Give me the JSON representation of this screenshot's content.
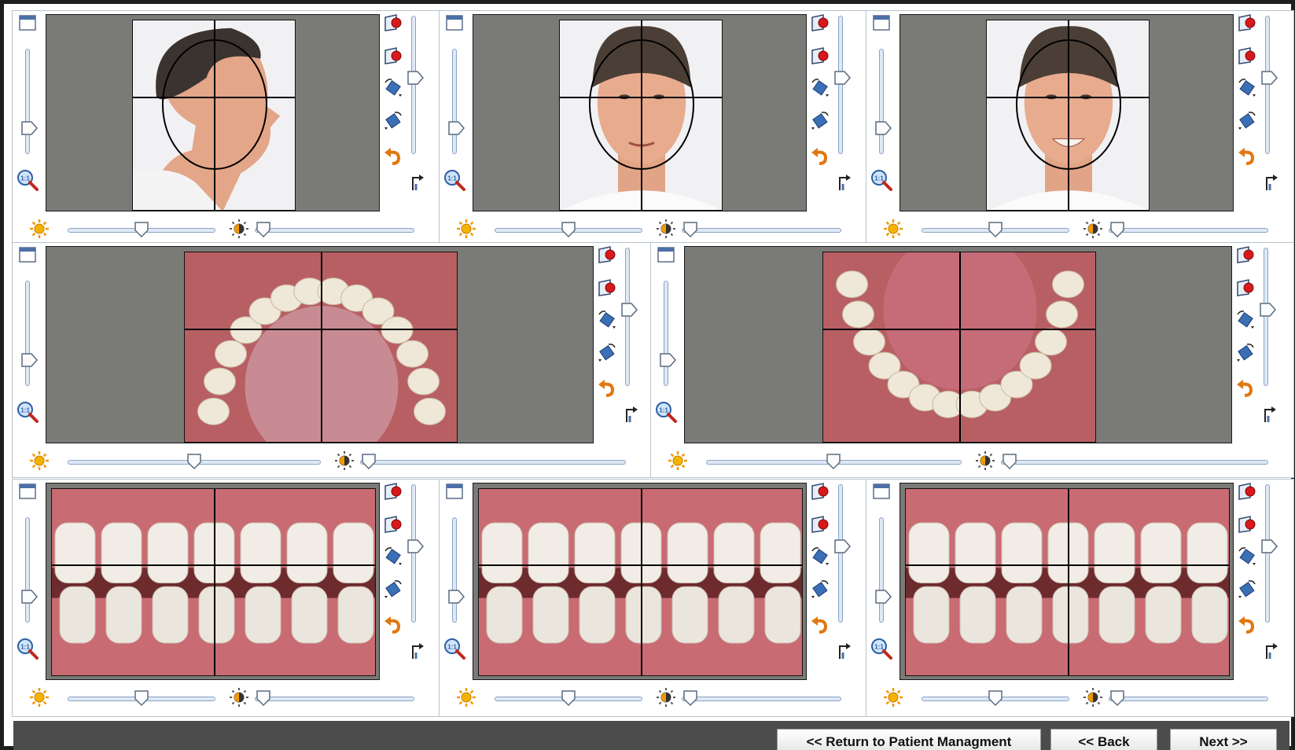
{
  "toolbar_icons": {
    "window": "window-icon",
    "zoom_actual": "zoom-actual-size-icon",
    "zoom_actual_label": "1:1",
    "capture_a": "capture-icon",
    "capture_b": "capture-icon",
    "rotate_cw": "rotate-clockwise-icon",
    "rotate_ccw": "rotate-counterclockwise-icon",
    "undo": "undo-icon",
    "flip": "flip-icon",
    "brightness": "brightness-icon",
    "contrast": "contrast-icon"
  },
  "colors": {
    "view_background": "#7a7a77",
    "panel_border": "#b9c3cc",
    "slider_fill": "#dfe8f4",
    "bottom_bar": "#4c4c4c",
    "capture_red": "#d9181b",
    "diamond_blue": "#3b6fb6"
  },
  "panels": [
    {
      "id": "extraoral-profile",
      "photo": "profile-face-photo",
      "overlay": "grid-oval"
    },
    {
      "id": "extraoral-frontal",
      "photo": "frontal-face-photo",
      "overlay": "grid-oval"
    },
    {
      "id": "extraoral-smile",
      "photo": "smiling-face-photo",
      "overlay": "grid-oval"
    },
    {
      "id": "intraoral-upper-occlusal",
      "photo": "upper-arch-photo",
      "overlay": "grid"
    },
    {
      "id": "intraoral-lower-occlusal",
      "photo": "lower-arch-photo",
      "overlay": "grid"
    },
    {
      "id": "intraoral-right-buccal",
      "photo": "right-buccal-photo",
      "overlay": "grid"
    },
    {
      "id": "intraoral-frontal",
      "photo": "frontal-teeth-photo",
      "overlay": "grid"
    },
    {
      "id": "intraoral-left-buccal",
      "photo": "left-buccal-photo",
      "overlay": "grid"
    }
  ],
  "slider_levels": {
    "zoom": 0.25,
    "rotation": 0.55,
    "brightness": 0.5,
    "contrast": 0.0
  },
  "navigation": {
    "return_label": "<< Return to Patient Managment",
    "back_label": "<< Back",
    "next_label": "Next >>"
  }
}
